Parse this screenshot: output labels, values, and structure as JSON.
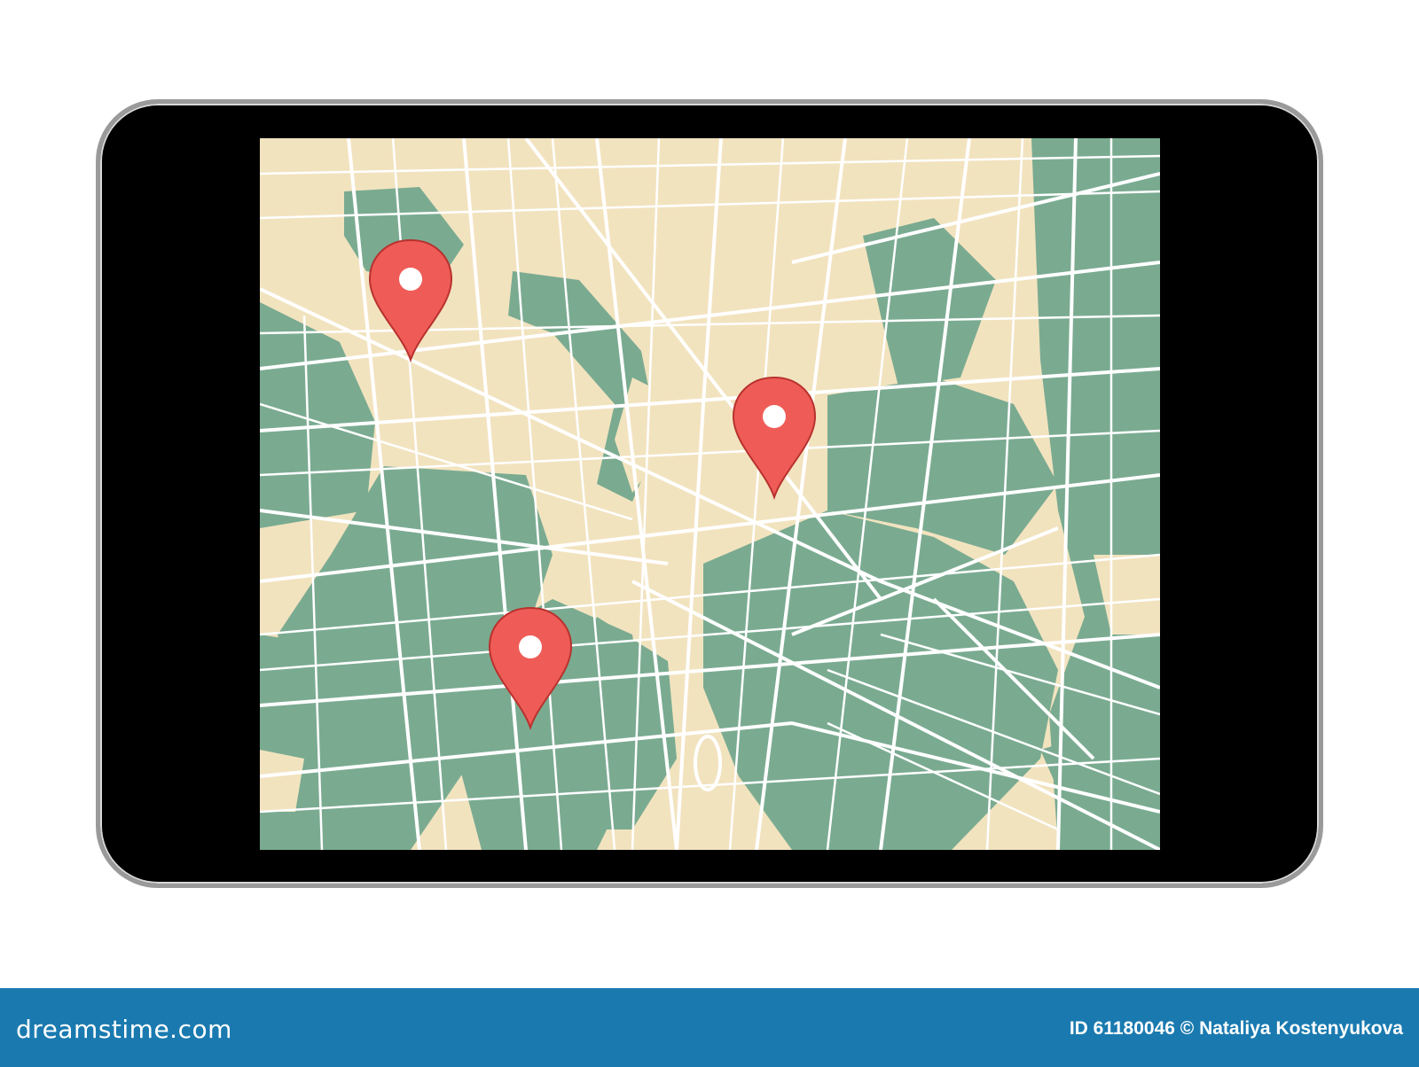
{
  "colors": {
    "park": "#7aab91",
    "land": "#f2e3bf",
    "road": "#ffffff",
    "pin": "#ef5c57",
    "bezel": "#000000",
    "footer": "#1a7ab0"
  },
  "map": {
    "pins": [
      {
        "name": "map-pin-1",
        "icon": "location-pin-icon"
      },
      {
        "name": "map-pin-2",
        "icon": "location-pin-icon"
      },
      {
        "name": "map-pin-3",
        "icon": "location-pin-icon"
      }
    ]
  },
  "footer": {
    "brand": "dreamstime.com",
    "credit": "ID 61180046 © Nataliya Kostenyukova"
  }
}
